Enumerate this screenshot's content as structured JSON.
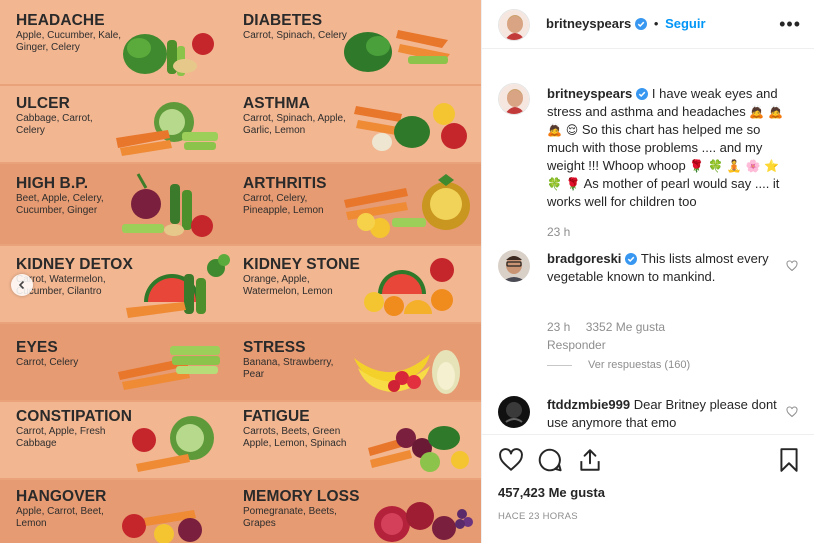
{
  "chart_rows": [
    {
      "left": {
        "title": "HEADACHE",
        "items": "Apple, Cucumber, Kale, Ginger, Celery"
      },
      "right": {
        "title": "DIABETES",
        "items": "Carrot, Spinach, Celery"
      }
    },
    {
      "left": {
        "title": "ULCER",
        "items": "Cabbage, Carrot, Celery"
      },
      "right": {
        "title": "ASTHMA",
        "items": "Carrot, Spinach, Apple, Garlic, Lemon"
      }
    },
    {
      "left": {
        "title": "HIGH B.P.",
        "items": "Beet, Apple, Celery, Cucumber, Ginger"
      },
      "right": {
        "title": "ARTHRITIS",
        "items": "Carrot, Celery, Pineapple, Lemon"
      }
    },
    {
      "left": {
        "title": "KIDNEY DETOX",
        "items": "Carrot, Watermelon, Cucumber, Cilantro"
      },
      "right": {
        "title": "KIDNEY STONE",
        "items": "Orange, Apple, Watermelon, Lemon"
      }
    },
    {
      "left": {
        "title": "EYES",
        "items": "Carrot, Celery"
      },
      "right": {
        "title": "STRESS",
        "items": "Banana, Strawberry, Pear"
      }
    },
    {
      "left": {
        "title": "CONSTIPATION",
        "items": "Carrot, Apple, Fresh Cabbage"
      },
      "right": {
        "title": "FATIGUE",
        "items": "Carrots, Beets, Green Apple, Lemon, Spinach"
      }
    },
    {
      "left": {
        "title": "HANGOVER",
        "items": "Apple, Carrot, Beet, Lemon"
      },
      "right": {
        "title": "MEMORY LOSS",
        "items": "Pomegranate, Beets, Grapes"
      }
    }
  ],
  "header": {
    "username": "britneyspears",
    "separator": "•",
    "follow": "Seguir",
    "more": "•••"
  },
  "caption": {
    "username": "britneyspears",
    "text_1": "I have weak eyes and stress and asthma and headaches",
    "text_2": "So this chart has helped me so much with those problems .... and my weight !!! Whoop whoop",
    "text_3": "As mother of pearl would say .... it works well for children too",
    "emoji_a": "🙇 🙇 🙇 😌",
    "emoji_b": "🌹 🍀 🧘",
    "emoji_c": "🌸 ⭐ 🍀 🌹",
    "time": "23 h"
  },
  "comments": [
    {
      "username": "bradgoreski",
      "text": "This lists almost every vegetable known to mankind.",
      "time": "23 h",
      "likes": "3352 Me gusta",
      "reply": "Responder",
      "view_replies": "Ver respuestas (160)"
    },
    {
      "username": "ftddzmbie999",
      "text": "Dear Britney please dont use anymore that emo"
    }
  ],
  "footer": {
    "likes": "457,423 Me gusta",
    "timestamp": "HACE 23 HORAS"
  },
  "colors": {
    "panel_bg": "#e9a27a",
    "row_light": "#f2b691",
    "row_dark": "#e69b72",
    "accent_blue": "#0095f6",
    "verified_blue": "#3897f0"
  }
}
